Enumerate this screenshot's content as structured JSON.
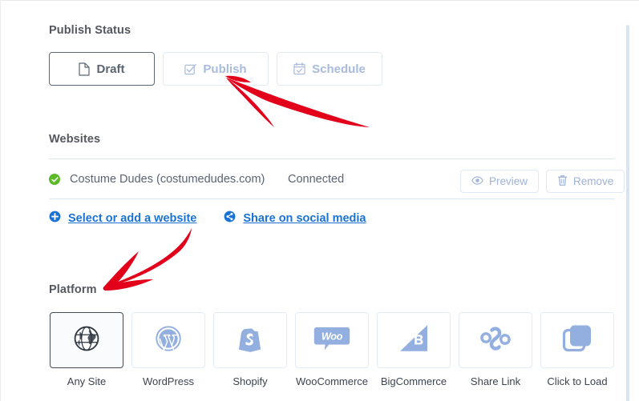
{
  "sections": {
    "publish_status": {
      "title": "Publish Status",
      "options": [
        {
          "label": "Draft",
          "icon": "document-icon",
          "state": "active"
        },
        {
          "label": "Publish",
          "icon": "check-square-icon",
          "state": "inactive"
        },
        {
          "label": "Schedule",
          "icon": "calendar-check-icon",
          "state": "inactive"
        }
      ]
    },
    "websites": {
      "title": "Websites",
      "rows": [
        {
          "status_icon": "green-check-circle-icon",
          "name": "Costume Dudes (costumedudes.com)",
          "status": "Connected",
          "actions": [
            {
              "label": "Preview",
              "icon": "eye-icon"
            },
            {
              "label": "Remove",
              "icon": "trash-icon"
            }
          ]
        }
      ],
      "links": [
        {
          "label": "Select or add a website",
          "icon": "plus-circle-icon"
        },
        {
          "label": "Share on social media",
          "icon": "share-circle-icon"
        }
      ]
    },
    "platform": {
      "title": "Platform",
      "tiles": [
        {
          "label": "Any Site",
          "icon": "globe-icon",
          "selected": true
        },
        {
          "label": "WordPress",
          "icon": "wordpress-icon",
          "selected": false
        },
        {
          "label": "Shopify",
          "icon": "shopify-bag-icon",
          "selected": false
        },
        {
          "label": "WooCommerce",
          "icon": "woo-icon",
          "selected": false
        },
        {
          "label": "BigCommerce",
          "icon": "bigcommerce-icon",
          "selected": false
        },
        {
          "label": "Share Link",
          "icon": "chain-link-icon",
          "selected": false
        },
        {
          "label": "Click to Load",
          "icon": "stacked-squares-icon",
          "selected": false
        }
      ]
    }
  },
  "annotations": {
    "arrow_color": "#e2001a",
    "items": [
      {
        "name": "arrow-pointing-to-publish",
        "target": "Publish"
      },
      {
        "name": "arrow-pointing-to-platform",
        "target": "Platform"
      }
    ]
  },
  "colors": {
    "link_blue": "#1a73d4",
    "muted_blue": "#a9bbdd",
    "text_dark": "#55585e",
    "connected_green": "#5bba27",
    "divider": "#dbe8f1"
  }
}
